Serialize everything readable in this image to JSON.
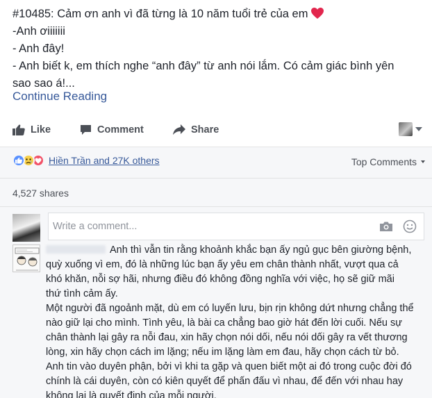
{
  "post": {
    "lines": [
      "#10485: Cảm ơn anh vì đã từng là 10 năm tuổi trẻ của em",
      "-Anh ơiiiiiii",
      "- Anh đây!",
      "- Anh biết k, em thích nghe “anh đây” từ anh nói lắm. Có cảm giác bình yên",
      "sao sao á!..."
    ],
    "emoji_icon": "red-heart-icon",
    "continue_label": "Continue Reading"
  },
  "actions": {
    "like_label": "Like",
    "comment_label": "Comment",
    "share_label": "Share"
  },
  "reactions": {
    "icons": [
      "like-icon",
      "sad-icon",
      "love-icon"
    ],
    "summary": "Hiền Trần and 27K others",
    "sort_label": "Top Comments"
  },
  "shares_label": "4,527 shares",
  "composer": {
    "placeholder": "Write a comment..."
  },
  "comment": {
    "lines": [
      "Anh thì vẫn tin rằng khoảnh khắc bạn ấy ngủ gục bên giường bệnh,",
      "quỳ xuống vì em, đó là những lúc bạn ấy yêu em chân thành nhất, vượt qua cả",
      "khó khăn, nỗi sợ hãi, nhưng điều đó không đồng nghĩa với việc, họ sẽ giữ mãi",
      "thứ tình cảm ấy.",
      "Một người đã ngoảnh mặt, dù em có luyến lưu, bịn rịn không dứt nhưng chẳng thể",
      "nào giữ lại cho mình. Tình yêu, là bài ca chẳng bao giờ hát đến lời cuối. Nếu sự",
      "chân thành lại gây ra nỗi đau, xin hãy chọn nói dối, nếu nói dối gây ra vết thương",
      "lòng, xin hãy chọn cách im lặng; nếu im lặng làm em đau, hãy chọn cách từ bỏ.",
      "Anh tin vào duyên phận, bởi vì khi ta gặp và quen biết một ai đó trong cuộc đời đó",
      "chính là cái duyên, còn có kiên quyết để phấn đấu vì nhau, để đến với nhau hay",
      "không lại là quyết định của mỗi người."
    ]
  },
  "colors": {
    "link": "#365899",
    "text": "#1d2129",
    "muted": "#4b4f56",
    "panel": "#f6f7f9",
    "like": "#5890ff",
    "love": "#f25268",
    "sad": "#f7d04a"
  }
}
